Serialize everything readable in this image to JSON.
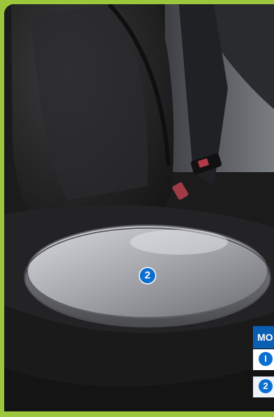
{
  "photo": {
    "marker_main": "2"
  },
  "legend": {
    "header": "MO",
    "rows": [
      {
        "marker": "I"
      },
      {
        "marker": "2"
      }
    ]
  },
  "colors": {
    "frame_green": "#9cc63b",
    "marker_blue": "#0b6fd0",
    "header_blue": "#0b5fb3"
  }
}
